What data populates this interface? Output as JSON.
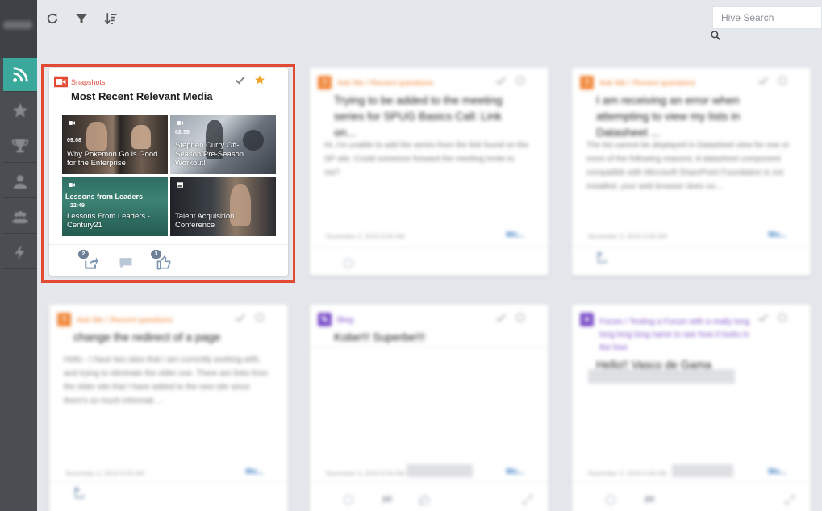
{
  "search": {
    "placeholder": "Hive Search"
  },
  "sidebar": {
    "items": [
      {
        "icon": "rss-icon",
        "active": true
      },
      {
        "icon": "star-icon"
      },
      {
        "icon": "trophy-icon"
      },
      {
        "icon": "user-icon"
      },
      {
        "icon": "group-icon"
      },
      {
        "icon": "lightning-icon"
      }
    ]
  },
  "toolbar": {
    "buttons": [
      "refresh-icon",
      "filter-icon",
      "sort-icon"
    ]
  },
  "main_card": {
    "category": "Snapshots",
    "title": "Most Recent Relevant Media",
    "tiles": [
      {
        "caption": "Why Pokemon Go is Good for the Enterprise",
        "duration": "09:08"
      },
      {
        "caption": "Stephen Curry Off-Season/Pre-Season Workout!",
        "duration": "02:58"
      },
      {
        "overlay": "Lessons from Leaders",
        "caption": "Lessons From Leaders - Century21",
        "duration": "22:49"
      },
      {
        "caption": "Talent Acquisition Conference"
      }
    ],
    "shares": "2",
    "likes": "3"
  },
  "cards": [
    {
      "category": "Ask Me / Recent questions",
      "title": "Trying to be added to the meeting series for SPUG Basics Call: Link on...",
      "body": "Hi, I'm unable to add the series from the link found on the SP site. Could someone forward the meeting invite to me?",
      "date": "November 3, 2016 9:34 AM",
      "more": "Mo..."
    },
    {
      "category": "Ask Me / Recent questions",
      "title": "I am receiving an error when attempting to view my lists in Datasheet ...",
      "body": "The list cannot be displayed in Datasheet view for one or more of the following reasons: A datasheet component compatible with Microsoft SharePoint Foundation is not installed, your web browser does no ...",
      "date": "November 3, 2016 9:34 AM",
      "more": "Mo..."
    },
    {
      "category": "Ask Me / Recent questions",
      "title": "change the redirect of a page",
      "body": "Hello - I have two sites that I am currently working with, and trying to eliminate the older one. There are links from the older site that I have added to the new site since there's so much informati ...",
      "date": "November 3, 2016 9:34 AM",
      "more": "Mo..."
    },
    {
      "category": "Blog",
      "title": "Kobe!!! Superbe!!!",
      "body": "",
      "date": "November 3, 2016 9:34 AM",
      "more": "Mo..."
    },
    {
      "category": "Forum / Testing a Forum with a really long long long long name to see how it looks in the hive",
      "title": "Hello!! Vasco de Gama",
      "body": "",
      "date": "November 3, 2016 9:34 AM",
      "more": "Mo..."
    }
  ],
  "colors": {
    "accent": "#3aa99b",
    "highlight": "#e34a35",
    "snapshot": "#e05548",
    "question": "#f0873a",
    "blog": "#7b4fc9",
    "star": "#f2a52b"
  }
}
